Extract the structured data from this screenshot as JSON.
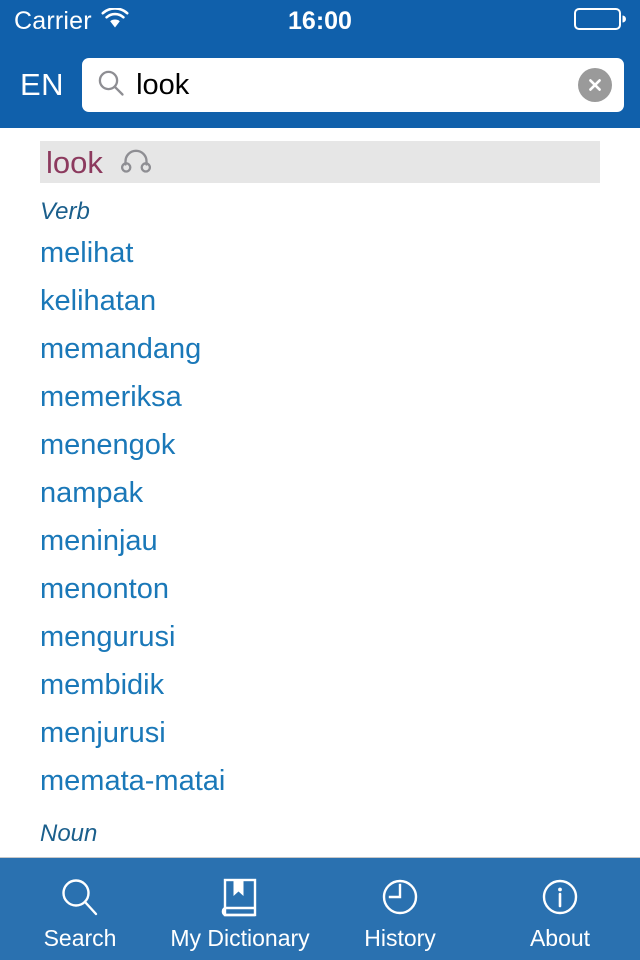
{
  "status_bar": {
    "carrier": "Carrier",
    "wifi_icon": "wifi-icon",
    "time": "16:00",
    "battery_icon": "battery-empty-icon"
  },
  "nav_bar": {
    "language_badge": "EN",
    "search": {
      "icon": "search-icon",
      "value": "look",
      "placeholder": "Search",
      "clear_icon": "clear-circle-icon"
    }
  },
  "entry": {
    "headword": "look",
    "audio_icon": "headphones-icon",
    "sections": [
      {
        "pos": "Verb",
        "translations": [
          "melihat",
          "kelihatan",
          "memandang",
          "memeriksa",
          "menengok",
          "nampak",
          "meninjau",
          "menonton",
          "mengurusi",
          "membidik",
          "menjurusi",
          "memata-matai"
        ]
      },
      {
        "pos": "Noun",
        "translations": []
      }
    ]
  },
  "tab_bar": {
    "items": [
      {
        "label": "Search",
        "icon": "magnifier-icon"
      },
      {
        "label": "My Dictionary",
        "icon": "book-bookmark-icon"
      },
      {
        "label": "History",
        "icon": "clock-icon"
      },
      {
        "label": "About",
        "icon": "info-circle-icon"
      }
    ]
  },
  "colors": {
    "nav_blue": "#1060ab",
    "tab_blue": "#2a71b0",
    "link_blue": "#1a78b8",
    "pos_blue": "#1b5f8c",
    "headword_maroon": "#8c3a5e",
    "headword_band": "#e6e6e6"
  }
}
